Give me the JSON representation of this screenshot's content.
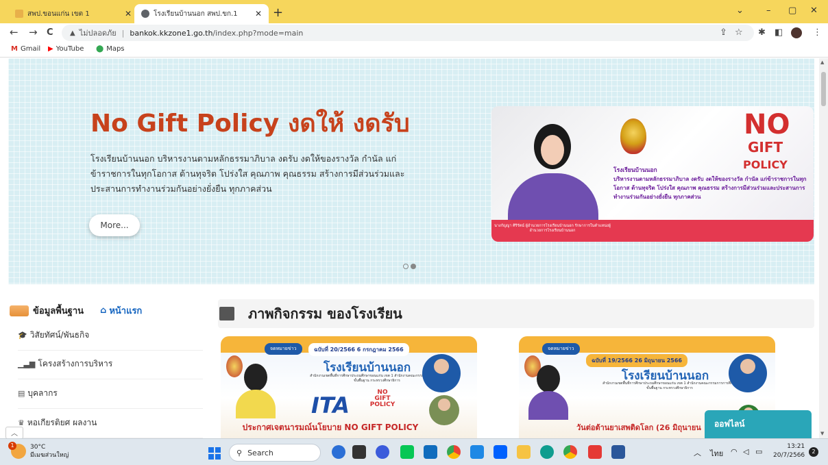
{
  "browser": {
    "tabs": [
      {
        "title": "สพป.ขอนแก่น เขต 1",
        "favicon_color": "#e8b04a",
        "active": false
      },
      {
        "title": "โรงเรียนบ้านนอก สพป.ขก.1",
        "favicon_color": "#5f6368",
        "active": true
      }
    ],
    "new_tab": "+",
    "window_controls": {
      "dropdown": "⌄",
      "minimize": "–",
      "restore": "▢",
      "close": "✕"
    },
    "nav": {
      "back": "←",
      "forward": "→",
      "reload": "C"
    },
    "address": {
      "security_label": "ไม่ปลอดภัย",
      "host": "bankok.kkzone1.go.th",
      "path": "/index.php?mode=main"
    },
    "bookmarks": [
      {
        "label": "Gmail",
        "icon": "gmail-icon",
        "color": "#d93025"
      },
      {
        "label": "YouTube",
        "icon": "youtube-icon",
        "color": "#ff0000"
      },
      {
        "label": "Maps",
        "icon": "maps-icon",
        "color": "#34a853"
      }
    ]
  },
  "hero": {
    "title": "No Gift Policy งดให้ งดรับ",
    "description": "โรงเรียนบ้านนอก บริหารงานตามหลักธรรมาภิบาล งดรับ งดให้ของรางวัล กำนัล แก่ข้าราชการในทุกโอกาส ต้านทุจริต โปร่งใส คุณภาพ คุณธรรม สร้างการมีส่วนร่วมและประสานการทำงานร่วมกันอย่างยั่งยืน ทุกภาคส่วน",
    "more_button": "More...",
    "slide_count": 2,
    "active_slide": 2,
    "banner": {
      "no": "NO",
      "gift": "GIFT",
      "policy": "POLICY",
      "school": "โรงเรียนบ้านนอก",
      "text": "บริหารงานตามหลักธรรมาภิบาล งดรับ งดให้ของรางวัล กำนัล แก่ข้าราชการในทุกโอกาส ต้านทุจริต โปร่งใส คุณภาพ คุณธรรม สร้างการมีส่วนร่วมและประสานการทำงานร่วมกันอย่างยั่งยืน ทุกภาคส่วน",
      "caption": "นางกัญญา ศิริรัตน์ ผู้อำนวยการโรงเรียนบ้านนอก รักษาการในตำแหน่งผู้อำนวยการโรงเรียนบ้านนอก"
    }
  },
  "sidebar": {
    "heading": "ข้อมูลพื้นฐาน",
    "home_link": "หน้าแรก",
    "items": [
      {
        "label": "วิสัยทัศน์/พันธกิจ",
        "icon": "graduation-cap-icon",
        "glyph": "🎓"
      },
      {
        "label": "โครงสร้างการบริหาร",
        "icon": "signal-bars-icon",
        "glyph": "📶"
      },
      {
        "label": "บุคลากร",
        "icon": "id-card-icon",
        "glyph": "🪪"
      },
      {
        "label": "หอเกียรติยศ ผลงาน",
        "icon": "trophy-icon",
        "glyph": "🏆"
      }
    ]
  },
  "activities": {
    "title": "ภาพกิจกรรม ของโรงเรียน",
    "cards": [
      {
        "tag": "จดหมายข่าว",
        "issue": "ฉบับที่ 20/2566 6 กรกฎาคม 2566",
        "school": "โรงเรียนบ้านนอก",
        "sub": "สำนักงานเขตพื้นที่การศึกษาประถมศึกษาขอนแก่น เขต 1 สำนักงานคณะกรรมการการศึกษาขั้นพื้นฐาน กระทรวงศึกษาธิการ",
        "ita": "ITA",
        "gift_logo": "NO GIFT POLICY",
        "headline": "ประกาศเจตนารมณ์นโยบาย NO GIFT POLICY"
      },
      {
        "tag": "จดหมายข่าว",
        "issue": "ฉบับที่ 19/2566 26 มิถุนายน 2566",
        "school": "โรงเรียนบ้านนอก",
        "sub": "สำนักงานเขตพื้นที่การศึกษาประถมศึกษาขอนแก่น เขต 1 สำนักงานคณะกรรมการการศึกษาขั้นพื้นฐาน กระทรวงศึกษาธิการ",
        "headline": "วันต่อต้านยาเสพติดโลก (26 มิถุนายน"
      }
    ]
  },
  "chat": {
    "status": "ออฟไลน์"
  },
  "taskbar": {
    "weather_temp": "30°C",
    "weather_desc": "มีเมฆส่วนใหญ่",
    "weather_badge": "1",
    "search_label": "Search",
    "apps": [
      {
        "icon": "bing-icon",
        "color": "#2b6fd6"
      },
      {
        "icon": "task-view-icon",
        "color": "#333333"
      },
      {
        "icon": "meet-icon",
        "color": "#3b5bdb"
      },
      {
        "icon": "line-icon",
        "color": "#06c755"
      },
      {
        "icon": "mail-icon",
        "color": "#0f6cbd"
      },
      {
        "icon": "chrome-icon",
        "color": "#ea4335"
      },
      {
        "icon": "amazon-icon",
        "color": "#1e88e5"
      },
      {
        "icon": "dropbox-icon",
        "color": "#0061fe"
      },
      {
        "icon": "file-explorer-icon",
        "color": "#f6c343"
      },
      {
        "icon": "edge-icon",
        "color": "#0f9d8f"
      },
      {
        "icon": "chrome-active-icon",
        "color": "#fbbc05"
      },
      {
        "icon": "acrobat-icon",
        "color": "#e53935"
      },
      {
        "icon": "word-icon",
        "color": "#2b579a"
      }
    ],
    "tray_lang": "ไทย",
    "time": "13:21",
    "date": "20/7/2566",
    "notif_count": "2"
  }
}
